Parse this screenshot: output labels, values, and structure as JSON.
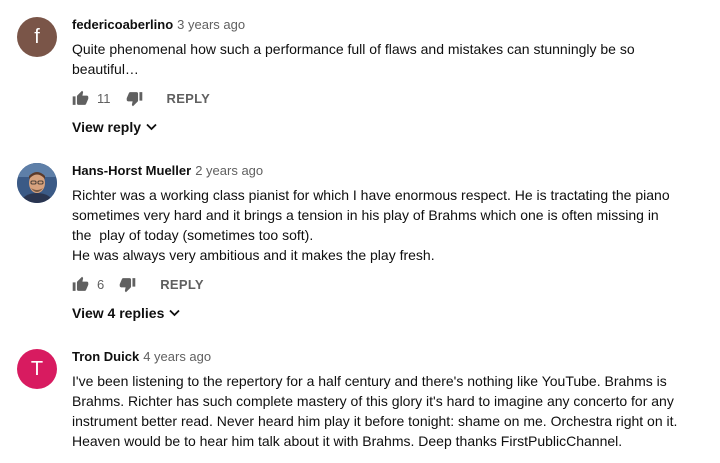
{
  "comments": [
    {
      "author": "federicoaberlino",
      "time": "3 years ago",
      "avatar_letter": "f",
      "avatar_color": "#7a5548",
      "text": "Quite phenomenal how such a performance full of flaws and mistakes can stunningly be so\nbeautiful…",
      "likes": "11",
      "reply_label": "REPLY",
      "view_replies": "View reply"
    },
    {
      "author": "Hans-Horst Mueller",
      "time": "2 years ago",
      "avatar_letter": "",
      "avatar_color": "#3b5a86",
      "text": "Richter was a working class pianist for which I have enormous respect. He is tractating the piano\nsometimes very hard and it brings a tension in his play of Brahms which one is often missing in\nthe  play of today (sometimes too soft).\nHe was always very ambitious and it makes the play fresh.",
      "likes": "6",
      "reply_label": "REPLY",
      "view_replies": "View 4 replies"
    },
    {
      "author": "Tron Duick",
      "time": "4 years ago",
      "avatar_letter": "T",
      "avatar_color": "#d81b60",
      "text": "I've been listening to the repertory for a half century and there's nothing like YouTube. Brahms is\nBrahms. Richter has such complete mastery of this glory it's hard to imagine any concerto for any\ninstrument better read. Never heard him play it before tonight: shame on me. Orchestra right on it.\nHeaven would be to hear him talk about it with Brahms. Deep thanks FirstPublicChannel."
    }
  ]
}
